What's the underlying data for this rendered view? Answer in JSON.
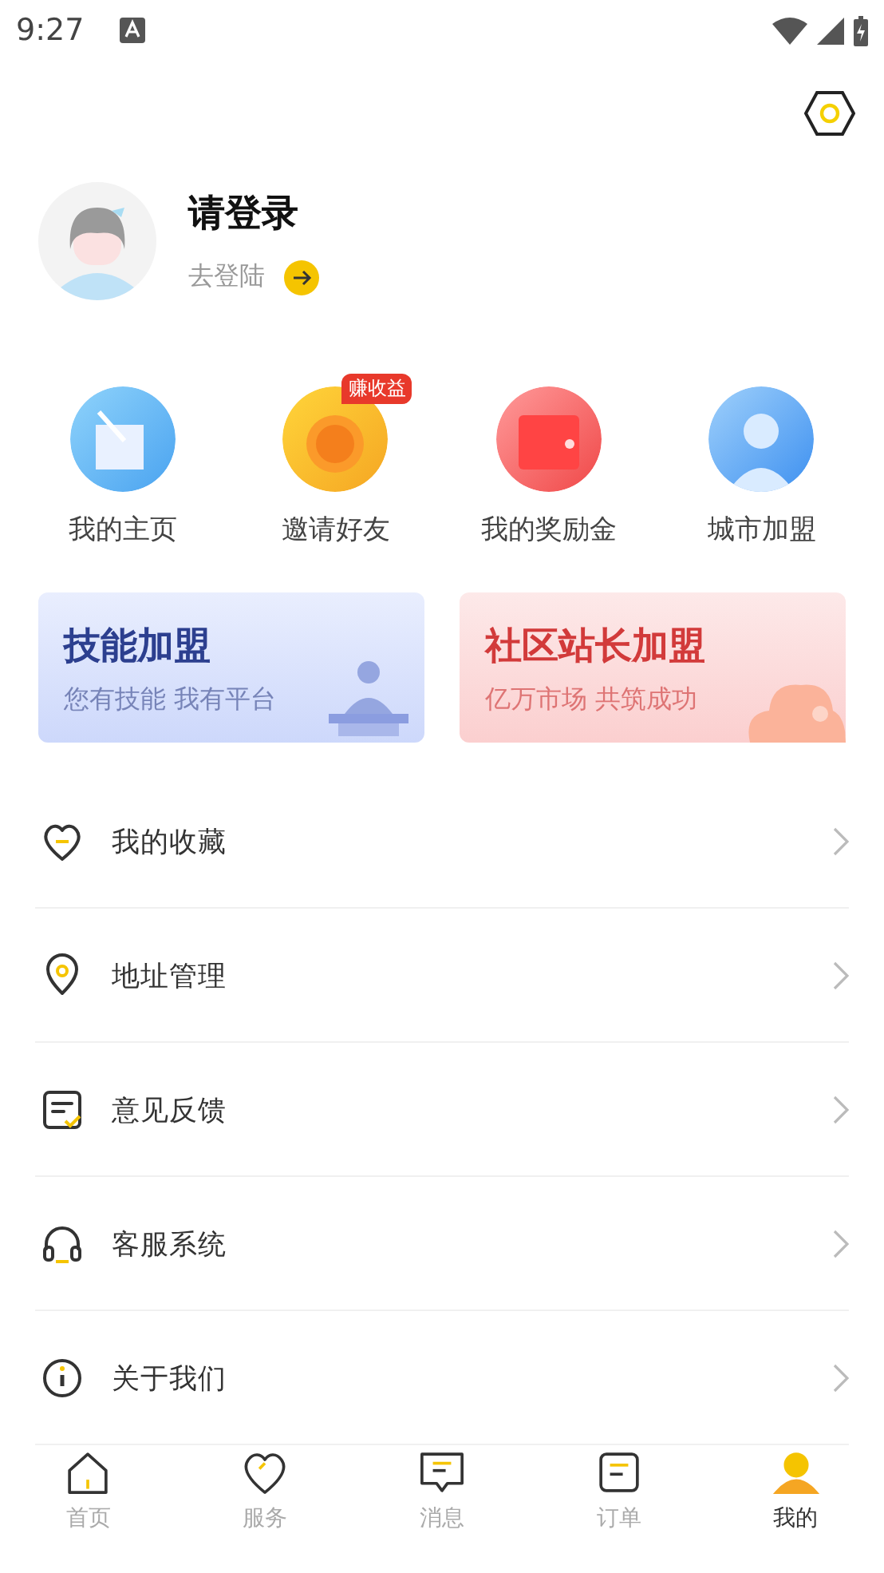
{
  "status_bar": {
    "time": "9:27"
  },
  "profile": {
    "title": "请登录",
    "login_link": "去登陆"
  },
  "shortcuts": [
    {
      "label": "我的主页",
      "kind": "notes"
    },
    {
      "label": "邀请好友",
      "kind": "coin",
      "badge": "赚收益"
    },
    {
      "label": "我的奖励金",
      "kind": "wallet"
    },
    {
      "label": "城市加盟",
      "kind": "person"
    }
  ],
  "banners": [
    {
      "title": "技能加盟",
      "subtitle": "您有技能 我有平台",
      "kind": "skill"
    },
    {
      "title": "社区站长加盟",
      "subtitle": "亿万市场 共筑成功",
      "kind": "community"
    }
  ],
  "menu": [
    {
      "label": "我的收藏",
      "kind": "heart"
    },
    {
      "label": "地址管理",
      "kind": "pin"
    },
    {
      "label": "意见反馈",
      "kind": "feedback"
    },
    {
      "label": "客服系统",
      "kind": "headset"
    },
    {
      "label": "关于我们",
      "kind": "info"
    }
  ],
  "tab_bar": [
    {
      "label": "首页",
      "kind": "home",
      "selected": false
    },
    {
      "label": "服务",
      "kind": "heart",
      "selected": false
    },
    {
      "label": "消息",
      "kind": "message",
      "selected": false
    },
    {
      "label": "订单",
      "kind": "order",
      "selected": false
    },
    {
      "label": "我的",
      "kind": "me",
      "selected": true
    }
  ]
}
